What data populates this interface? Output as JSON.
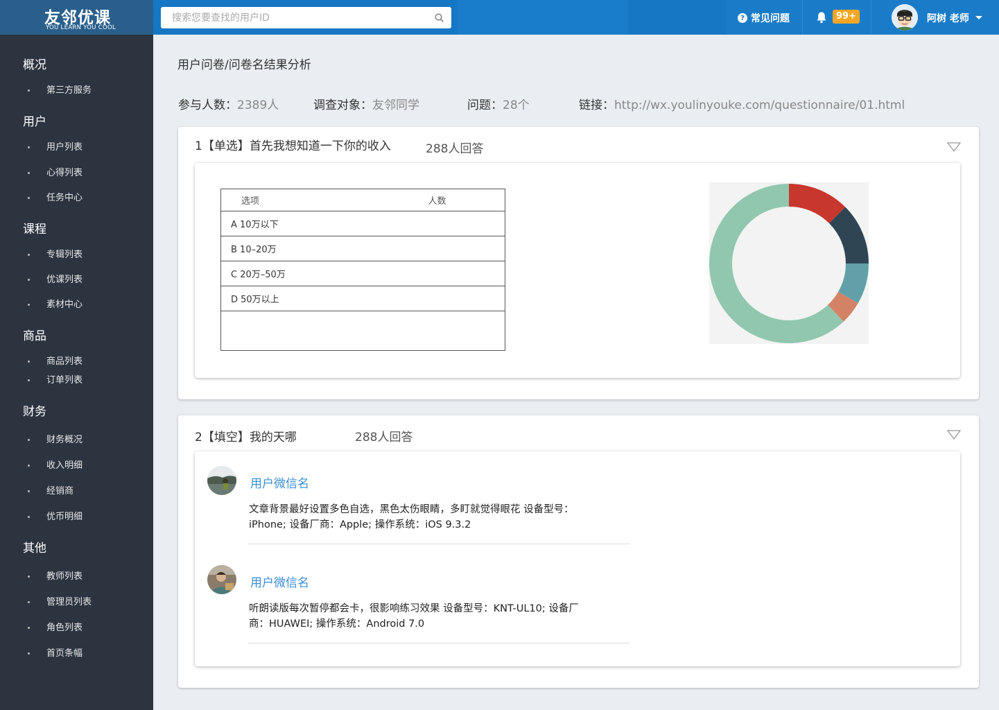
{
  "logo": {
    "brand": "友邻优课",
    "tagline": "YOU LEARN YOU COOL"
  },
  "search": {
    "placeholder": "搜索您要查找的用户ID"
  },
  "header": {
    "help_label": "常见问题",
    "notifications": "99+",
    "user_name": "阿树 老师"
  },
  "sidebar": {
    "sections": [
      {
        "title": "概况",
        "items": [
          "第三方服务"
        ]
      },
      {
        "title": "用户",
        "items": [
          "用户列表",
          "心得列表",
          "任务中心"
        ]
      },
      {
        "title": "课程",
        "items": [
          "专辑列表",
          "优课列表",
          "素材中心"
        ]
      },
      {
        "title": "商品",
        "items": [
          "商品列表",
          "订单列表"
        ]
      },
      {
        "title": "财务",
        "items": [
          "财务概况",
          "收入明细",
          "经销商",
          "优币明细"
        ]
      },
      {
        "title": "其他",
        "items": [
          "教师列表",
          "管理员列表",
          "角色列表",
          "首页条幅"
        ]
      }
    ]
  },
  "page": {
    "breadcrumb": "用户问卷/问卷名结果分析",
    "stats": {
      "participants_label": "参与人数：",
      "participants_value": "2389人",
      "target_label": "调查对象：",
      "target_value": "友邻同学",
      "questions_label": "问题：",
      "questions_value": "28个",
      "link_label": "链接：",
      "link_value": "http://wx.youlinyouke.com/questionnaire/01.html"
    }
  },
  "q1": {
    "title": "1【单选】首先我想知道一下你的收入",
    "count": "288人回答",
    "table": {
      "headers": [
        "选项",
        "人数"
      ],
      "rows": [
        "A 10万以下",
        "B 10–20万",
        "C 20万–50万",
        "D 50万以上"
      ]
    }
  },
  "chart_data": {
    "type": "pie",
    "donut": true,
    "values": [
      12.5,
      12.5,
      8.3,
      4.7,
      62.0
    ],
    "colors": [
      "#c8372d",
      "#2f4554",
      "#61a0a8",
      "#d48265",
      "#91c7ae"
    ]
  },
  "q2": {
    "title": "2【填空】我的天哪",
    "count": "288人回答",
    "entries": [
      {
        "name": "用户微信名",
        "text": "文章背景最好设置多色自选，黑色太伤眼睛，多盯就觉得眼花 设备型号：iPhone; 设备厂商：Apple; 操作系统：iOS 9.3.2"
      },
      {
        "name": "用户微信名",
        "text": "听朗读版每次暂停都会卡，很影响练习效果 设备型号：KNT-UL10; 设备厂商：HUAWEI; 操作系统：Android 7.0"
      }
    ]
  }
}
